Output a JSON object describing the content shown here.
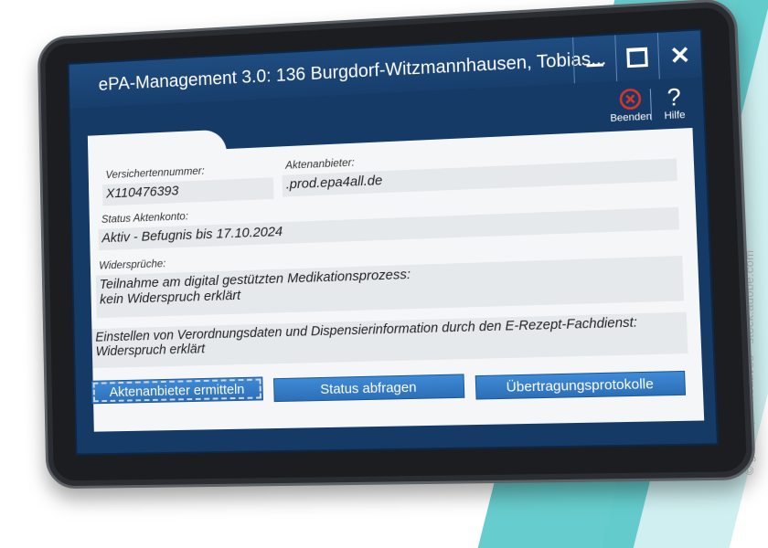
{
  "window": {
    "title": "ePA-Management 3.0: 136 Burgdorf-Witzmannhausen, Tobias..."
  },
  "toolbar": {
    "beenden_label": "Beenden",
    "hilfe_label": "Hilfe",
    "hilfe_glyph": "?"
  },
  "form": {
    "versichertennummer_label": "Versichertennummer:",
    "versichertennummer_value": "X110476393",
    "aktenanbieter_label": "Aktenanbieter:",
    "aktenanbieter_value": ".prod.epa4all.de",
    "status_label": "Status Aktenkonto:",
    "status_value": "Aktiv - Befugnis bis 17.10.2024",
    "widersprueche_label": "Widersprüche:",
    "widerspruch1_line1": "Teilnahme am digital gestützten Medikationsprozess:",
    "widerspruch1_line2": "kein Widerspruch erklärt",
    "widerspruch2_line1": "Einstellen von Verordnungsdaten und Dispensierinformation durch den E-Rezept-Fachdienst:",
    "widerspruch2_line2": "Widerspruch erklärt"
  },
  "buttons": {
    "aktenanbieter": "Aktenanbieter ermitteln",
    "status": "Status abfragen",
    "protokolle": "Übertragungsprotokolle"
  },
  "watermark": "© grafius, J Creatives - stock.adobe.com",
  "colors": {
    "accent": "#2c6fb6",
    "title_bar": "#1f4c80",
    "close_icon": "#d9342b"
  }
}
